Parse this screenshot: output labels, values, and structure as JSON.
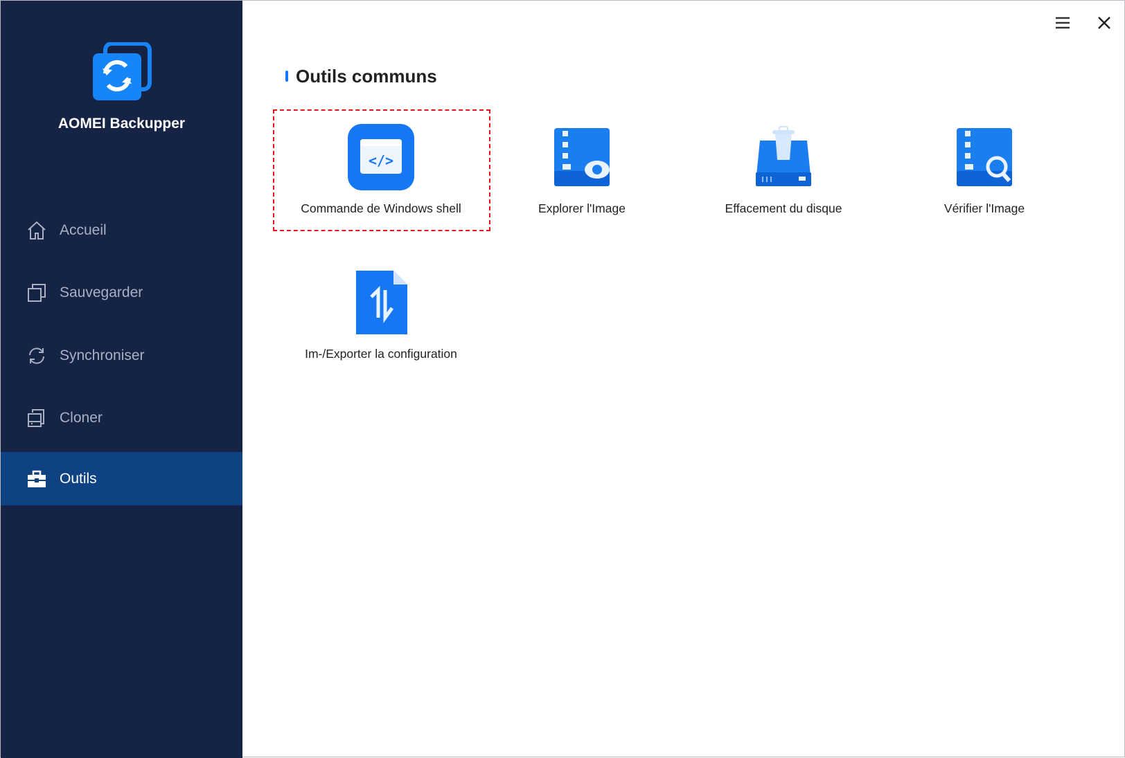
{
  "app": {
    "title": "AOMEI Backupper"
  },
  "sidebar": {
    "items": [
      {
        "label": "Accueil",
        "icon": "home-icon"
      },
      {
        "label": "Sauvegarder",
        "icon": "backup-icon"
      },
      {
        "label": "Synchroniser",
        "icon": "sync-icon"
      },
      {
        "label": "Cloner",
        "icon": "clone-icon"
      },
      {
        "label": "Outils",
        "icon": "toolbox-icon",
        "active": true
      }
    ]
  },
  "main": {
    "heading": "Outils communs",
    "tools": [
      {
        "label": "Commande de Windows shell",
        "icon": "shell-command-icon",
        "highlighted": true
      },
      {
        "label": "Explorer l'Image",
        "icon": "explore-image-icon"
      },
      {
        "label": "Effacement du disque",
        "icon": "disk-wipe-icon"
      },
      {
        "label": "Vérifier l'Image",
        "icon": "check-image-icon"
      },
      {
        "label": "Im-/Exporter la configuration",
        "icon": "import-export-icon"
      }
    ]
  },
  "colors": {
    "sidebar": "#152345",
    "active": "#0f4282",
    "accent": "#1677ff",
    "highlight": "#e8141a"
  }
}
